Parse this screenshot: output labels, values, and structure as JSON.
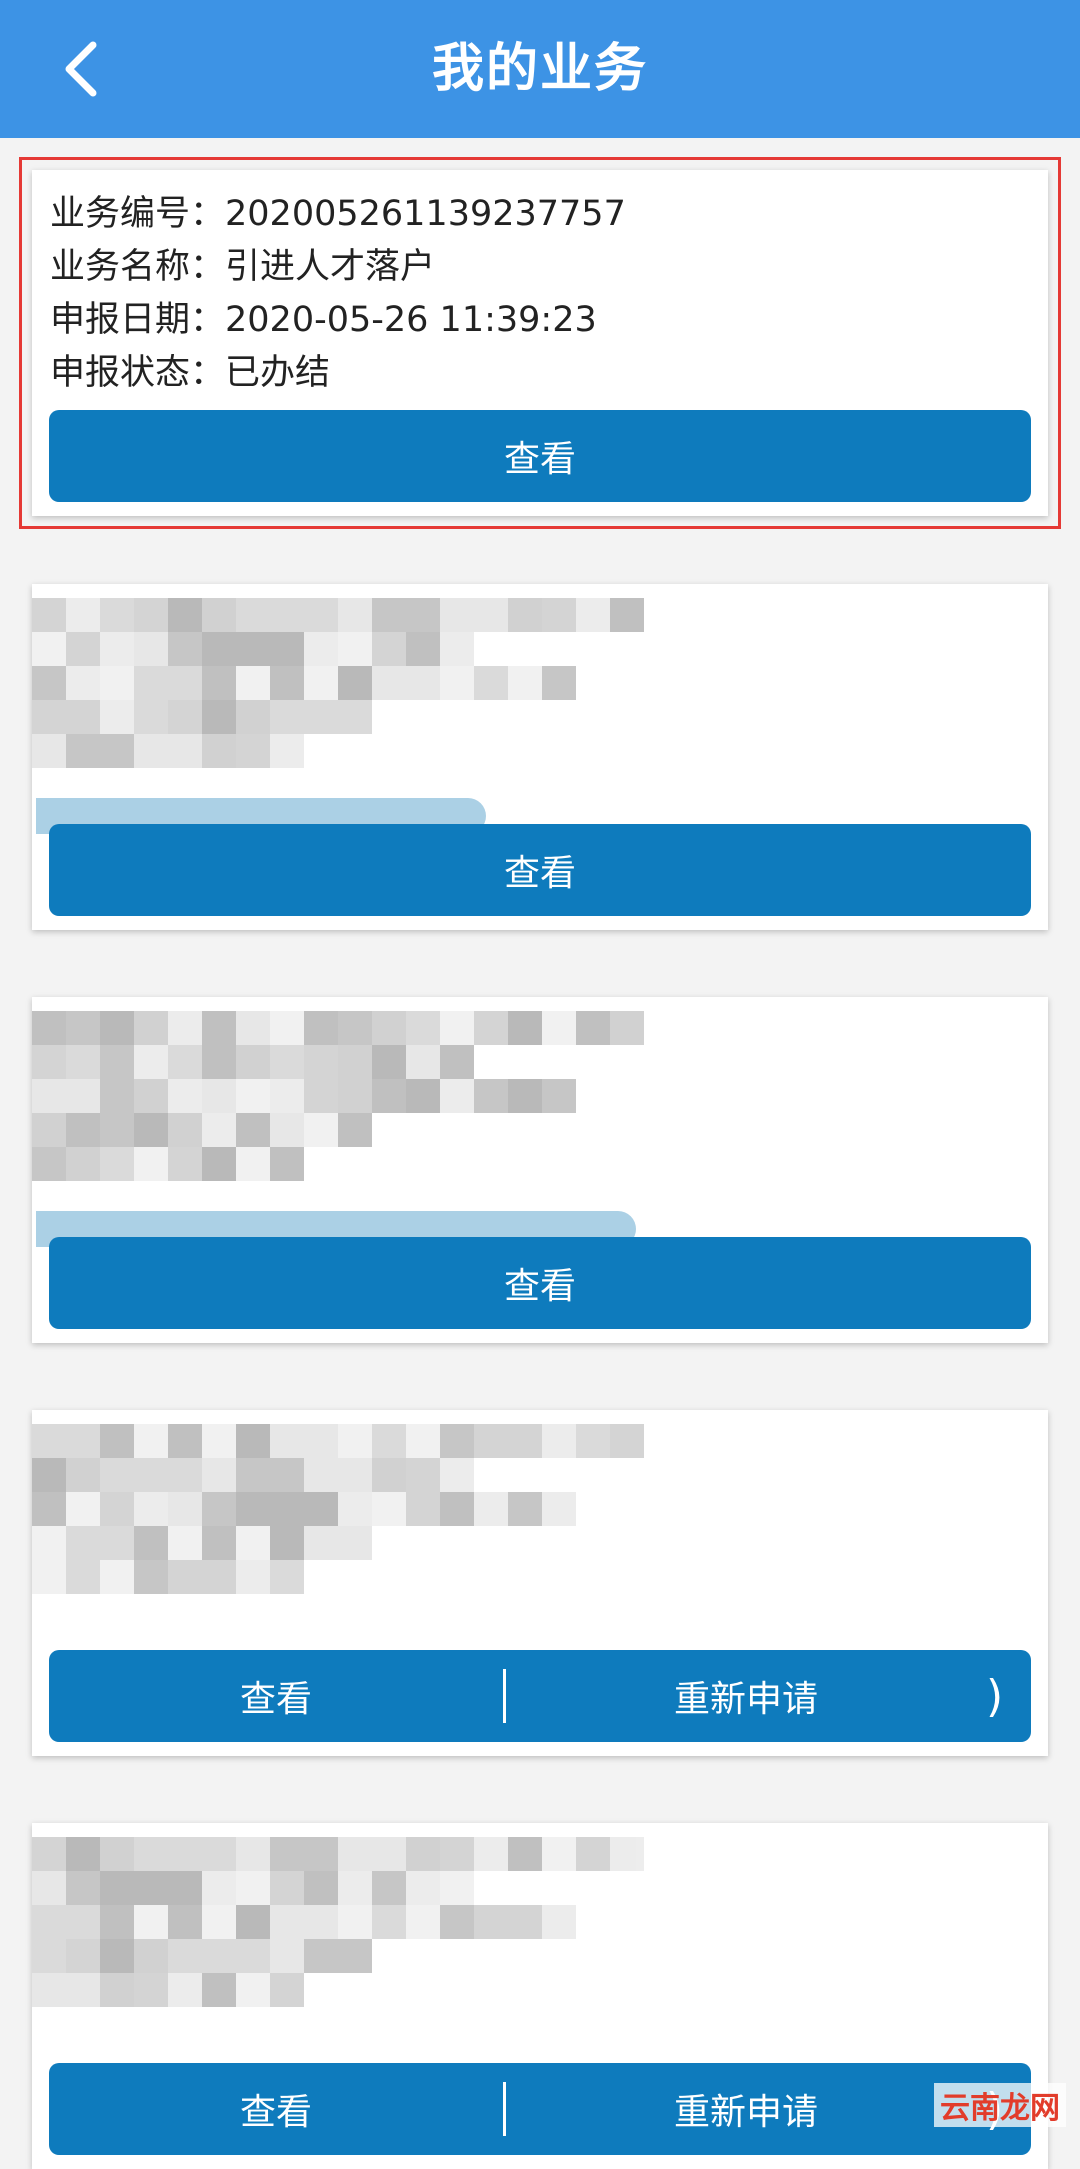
{
  "header": {
    "title": "我的业务",
    "back_icon": "chevron-left-icon"
  },
  "cards": [
    {
      "fields": [
        {
          "label": "业务编号：",
          "value": "202005261139237757"
        },
        {
          "label": "业务名称：",
          "value": "引进人才落户"
        },
        {
          "label": "申报日期：",
          "value": "2020-05-26 11:39:23"
        },
        {
          "label": "申报状态：",
          "value": "已办结"
        }
      ],
      "button": "查看"
    },
    {
      "button": "查看"
    },
    {
      "button": "查看"
    },
    {
      "button_left": "查看",
      "button_right": "重新申请",
      "button_right_suffix": ")"
    },
    {
      "button_left": "查看",
      "button_right": "重新申请",
      "button_right_suffix": ")"
    }
  ],
  "watermark": "云南龙网",
  "colors": {
    "header": "#3d93e5",
    "button": "#0e7bbd",
    "highlight": "#e53935"
  }
}
